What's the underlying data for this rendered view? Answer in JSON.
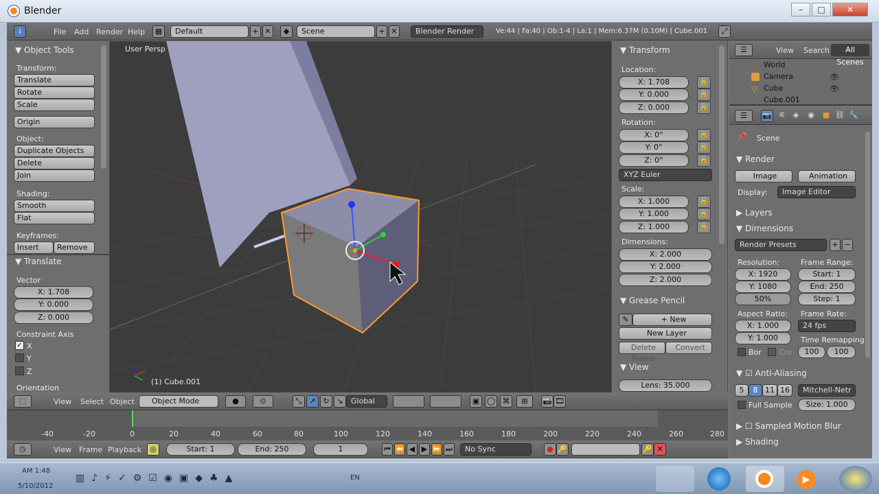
{
  "window": {
    "title": "Blender"
  },
  "topbar": {
    "menus": [
      "File",
      "Add",
      "Render",
      "Help"
    ],
    "screen_layout": "Default",
    "scene": "Scene",
    "engine": "Blender Render",
    "stats": "Ve:44 | Fa:40 | Ob:1-4 | La:1 | Mem:6.37M (0.10M) | Cube.001"
  },
  "tools": {
    "title": "Object Tools",
    "transform_label": "Transform:",
    "translate": "Translate",
    "rotate": "Rotate",
    "scale": "Scale",
    "origin": "Origin",
    "object_label": "Object:",
    "duplicate": "Duplicate Objects",
    "delete": "Delete",
    "join": "Join",
    "shading_label": "Shading:",
    "smooth": "Smooth",
    "flat": "Flat",
    "keyframes_label": "Keyframes:",
    "insert": "Insert",
    "remove": "Remove"
  },
  "operator": {
    "title": "Translate",
    "vector_label": "Vector",
    "x": "X: 1.708",
    "y": "Y: 0.000",
    "z": "Z: 0.000",
    "constraint_label": "Constraint Axis",
    "cx": "X",
    "cy": "Y",
    "cz": "Z",
    "orientation_label": "Orientation"
  },
  "viewport": {
    "view_name": "User Persp",
    "object_name": "(1) Cube.001"
  },
  "properties_n": {
    "transform_title": "Transform",
    "location_label": "Location:",
    "loc_x": "X: 1.708",
    "loc_y": "Y: 0.000",
    "loc_z": "Z: 0.000",
    "rotation_label": "Rotation:",
    "rot_x": "X: 0°",
    "rot_y": "Y: 0°",
    "rot_z": "Z: 0°",
    "rotation_mode": "XYZ Euler",
    "scale_label": "Scale:",
    "sc_x": "X: 1.000",
    "sc_y": "Y: 1.000",
    "sc_z": "Z: 1.000",
    "dimensions_label": "Dimensions:",
    "dim_x": "X: 2.000",
    "dim_y": "Y: 2.000",
    "dim_z": "Z: 2.000",
    "grease_title": "Grease Pencil",
    "new": "New",
    "new_layer": "New Layer",
    "delete_frame": "Delete Frame",
    "convert": "Convert",
    "view_title": "View",
    "lens": "Lens: 35.000"
  },
  "outliner": {
    "view": "View",
    "search": "Search",
    "all_scenes": "All Scenes",
    "items": [
      "World",
      "Camera",
      "Cube",
      "Cube.001"
    ]
  },
  "render": {
    "scene_label": "Scene",
    "render_title": "Render",
    "image": "Image",
    "animation": "Animation",
    "display_label": "Display:",
    "display_value": "Image Editor",
    "layers": "Layers",
    "dimensions": "Dimensions",
    "presets": "Render Presets",
    "resolution_label": "Resolution:",
    "res_x": "X: 1920",
    "res_y": "Y: 1080",
    "res_pct": "50%",
    "frame_range_label": "Frame Range:",
    "start": "Start: 1",
    "end": "End: 250",
    "step": "Step: 1",
    "aspect_label": "Aspect Ratio:",
    "asp_x": "X: 1.000",
    "asp_y": "Y: 1.000",
    "frame_rate_label": "Frame Rate:",
    "fps": "24 fps",
    "remap_label": "Time Remapping:",
    "remap_old": "100",
    "remap_new": "100",
    "bor": "Bor",
    "cro": "Cro",
    "aa_title": "Anti-Aliasing",
    "aa_5": "5",
    "aa_8": "8",
    "aa_11": "11",
    "aa_16": "16",
    "aa_filter": "Mitchell-Netr",
    "full_sample": "Full Sample",
    "aa_size": "Size: 1.000",
    "motion_blur": "Sampled Motion Blur",
    "shading": "Shading"
  },
  "view3d_header": {
    "view": "View",
    "select": "Select",
    "object": "Object",
    "mode": "Object Mode",
    "orientation": "Global"
  },
  "timeline": {
    "ticks": [
      "-40",
      "-20",
      "0",
      "20",
      "40",
      "60",
      "80",
      "100",
      "120",
      "140",
      "160",
      "180",
      "200",
      "220",
      "240",
      "260",
      "280"
    ],
    "view": "View",
    "frame": "Frame",
    "playback": "Playback",
    "start": "Start: 1",
    "end": "End: 250",
    "current": "1",
    "sync": "No Sync"
  },
  "taskbar": {
    "time": "AM 1:48",
    "date": "5/10/2012",
    "lang": "EN"
  }
}
